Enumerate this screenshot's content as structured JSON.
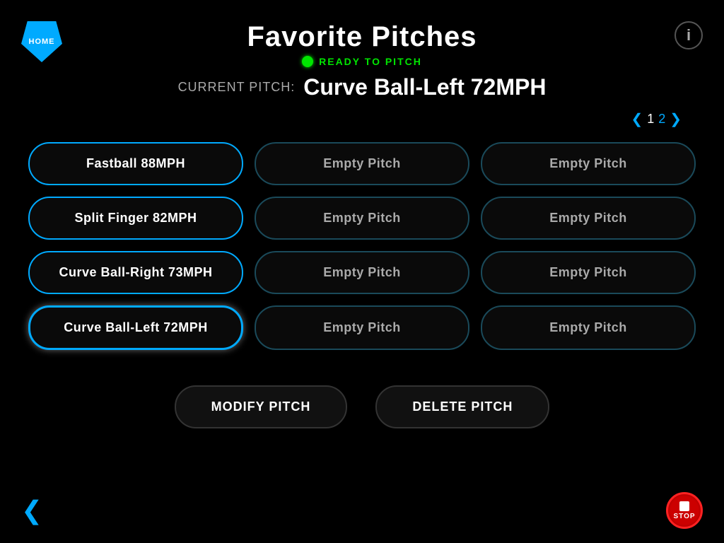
{
  "header": {
    "title": "Favorite Pitches",
    "ready_label": "READY TO PITCH",
    "current_pitch_label": "CURRENT PITCH:",
    "current_pitch_value": "Curve Ball-Left 72MPH"
  },
  "home_button": "HOME",
  "info_button": "i",
  "pagination": {
    "page1": "1",
    "page2": "2",
    "left_arrow": "❮",
    "right_arrow": "❯"
  },
  "pitches": {
    "col1": [
      {
        "label": "Fastball 88MPH",
        "selected": false,
        "empty": false
      },
      {
        "label": "Split Finger 82MPH",
        "selected": false,
        "empty": false
      },
      {
        "label": "Curve Ball-Right 73MPH",
        "selected": false,
        "empty": false
      },
      {
        "label": "Curve Ball-Left 72MPH",
        "selected": true,
        "empty": false
      }
    ],
    "col2": [
      {
        "label": "Empty Pitch",
        "selected": false,
        "empty": true
      },
      {
        "label": "Empty Pitch",
        "selected": false,
        "empty": true
      },
      {
        "label": "Empty Pitch",
        "selected": false,
        "empty": true
      },
      {
        "label": "Empty Pitch",
        "selected": false,
        "empty": true
      }
    ],
    "col3": [
      {
        "label": "Empty Pitch",
        "selected": false,
        "empty": true
      },
      {
        "label": "Empty Pitch",
        "selected": false,
        "empty": true
      },
      {
        "label": "Empty Pitch",
        "selected": false,
        "empty": true
      },
      {
        "label": "Empty Pitch",
        "selected": false,
        "empty": true
      }
    ]
  },
  "buttons": {
    "modify": "MODIFY PITCH",
    "delete": "DELETE PITCH"
  },
  "stop_label": "STOP"
}
